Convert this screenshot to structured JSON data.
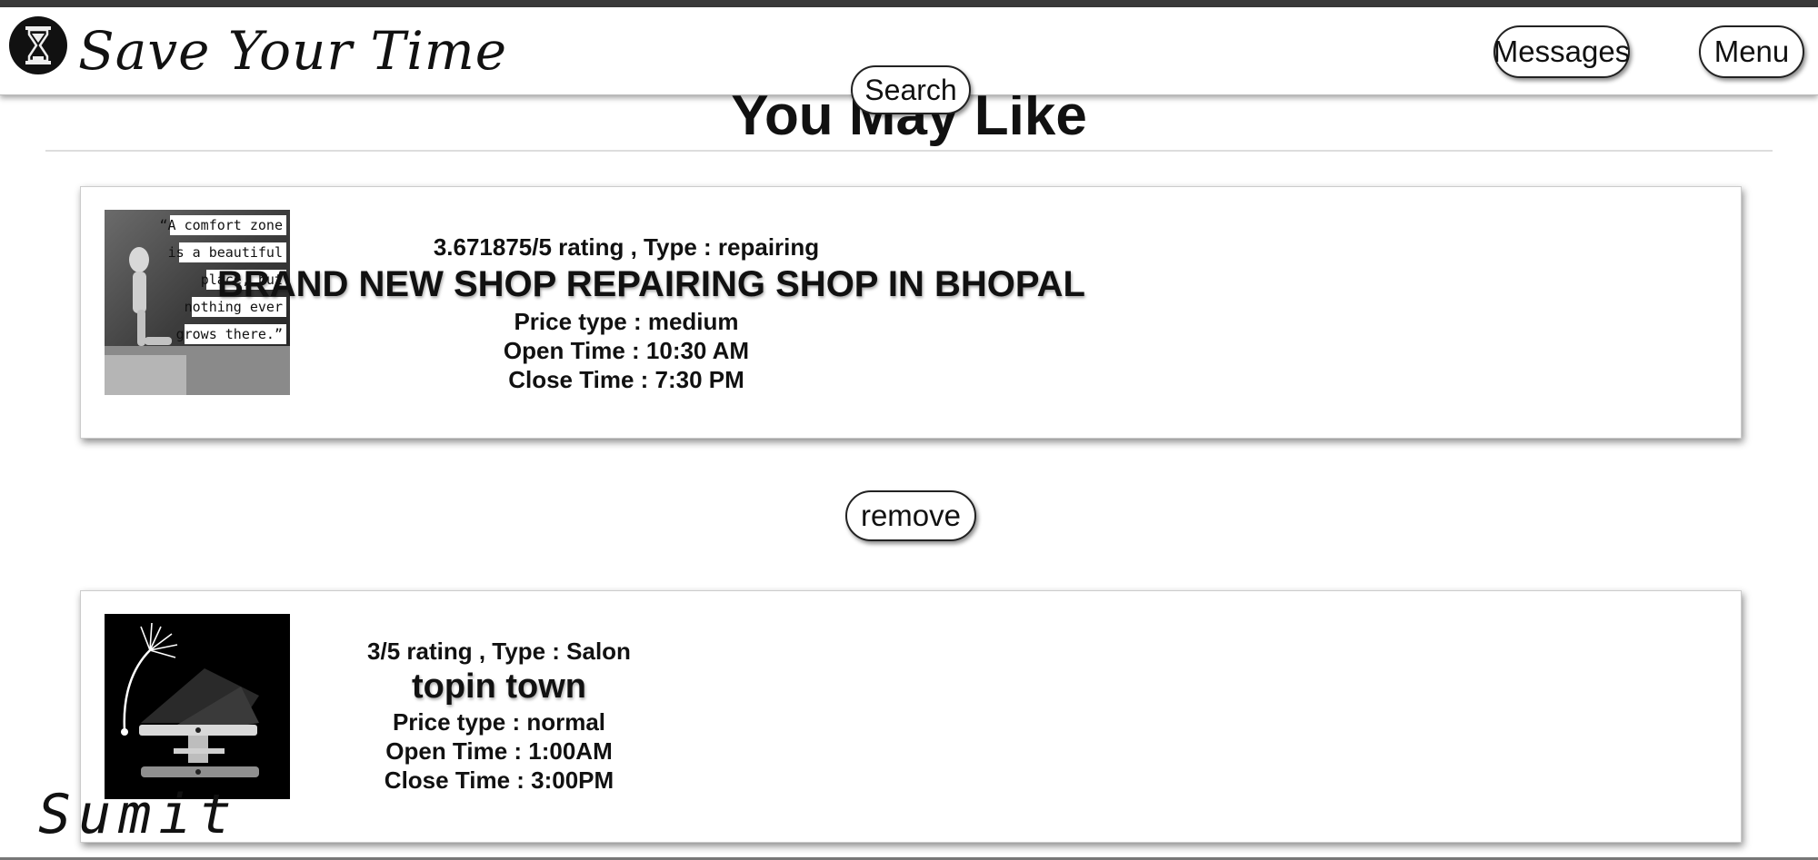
{
  "header": {
    "brand": "Save Your Time",
    "messages_label": "Messages",
    "menu_label": "Menu",
    "search_label": "Search"
  },
  "page": {
    "heading": "You May Like",
    "remove_label": "remove"
  },
  "cards": [
    {
      "rating_type": "3.671875/5 rating , Type : repairing",
      "name": "BRAND NEW SHOP REPAIRING SHOP IN BHOPAL",
      "price_type": "Price type : medium",
      "open_time": "Open Time : 10:30 AM",
      "close_time": "Close Time : 7:30 PM",
      "image_quote": [
        "“A comfort zone",
        "is a beautiful",
        "place, but",
        "nothing ever",
        "grows there.”"
      ]
    },
    {
      "rating_type": "3/5 rating , Type : Salon",
      "name": "topin town",
      "price_type": "Price type : normal",
      "open_time": "Open Time : 1:00AM",
      "close_time": "Close Time : 3:00PM"
    }
  ],
  "signature": "Sumit",
  "icons": {
    "logo": "hourglass-icon"
  }
}
